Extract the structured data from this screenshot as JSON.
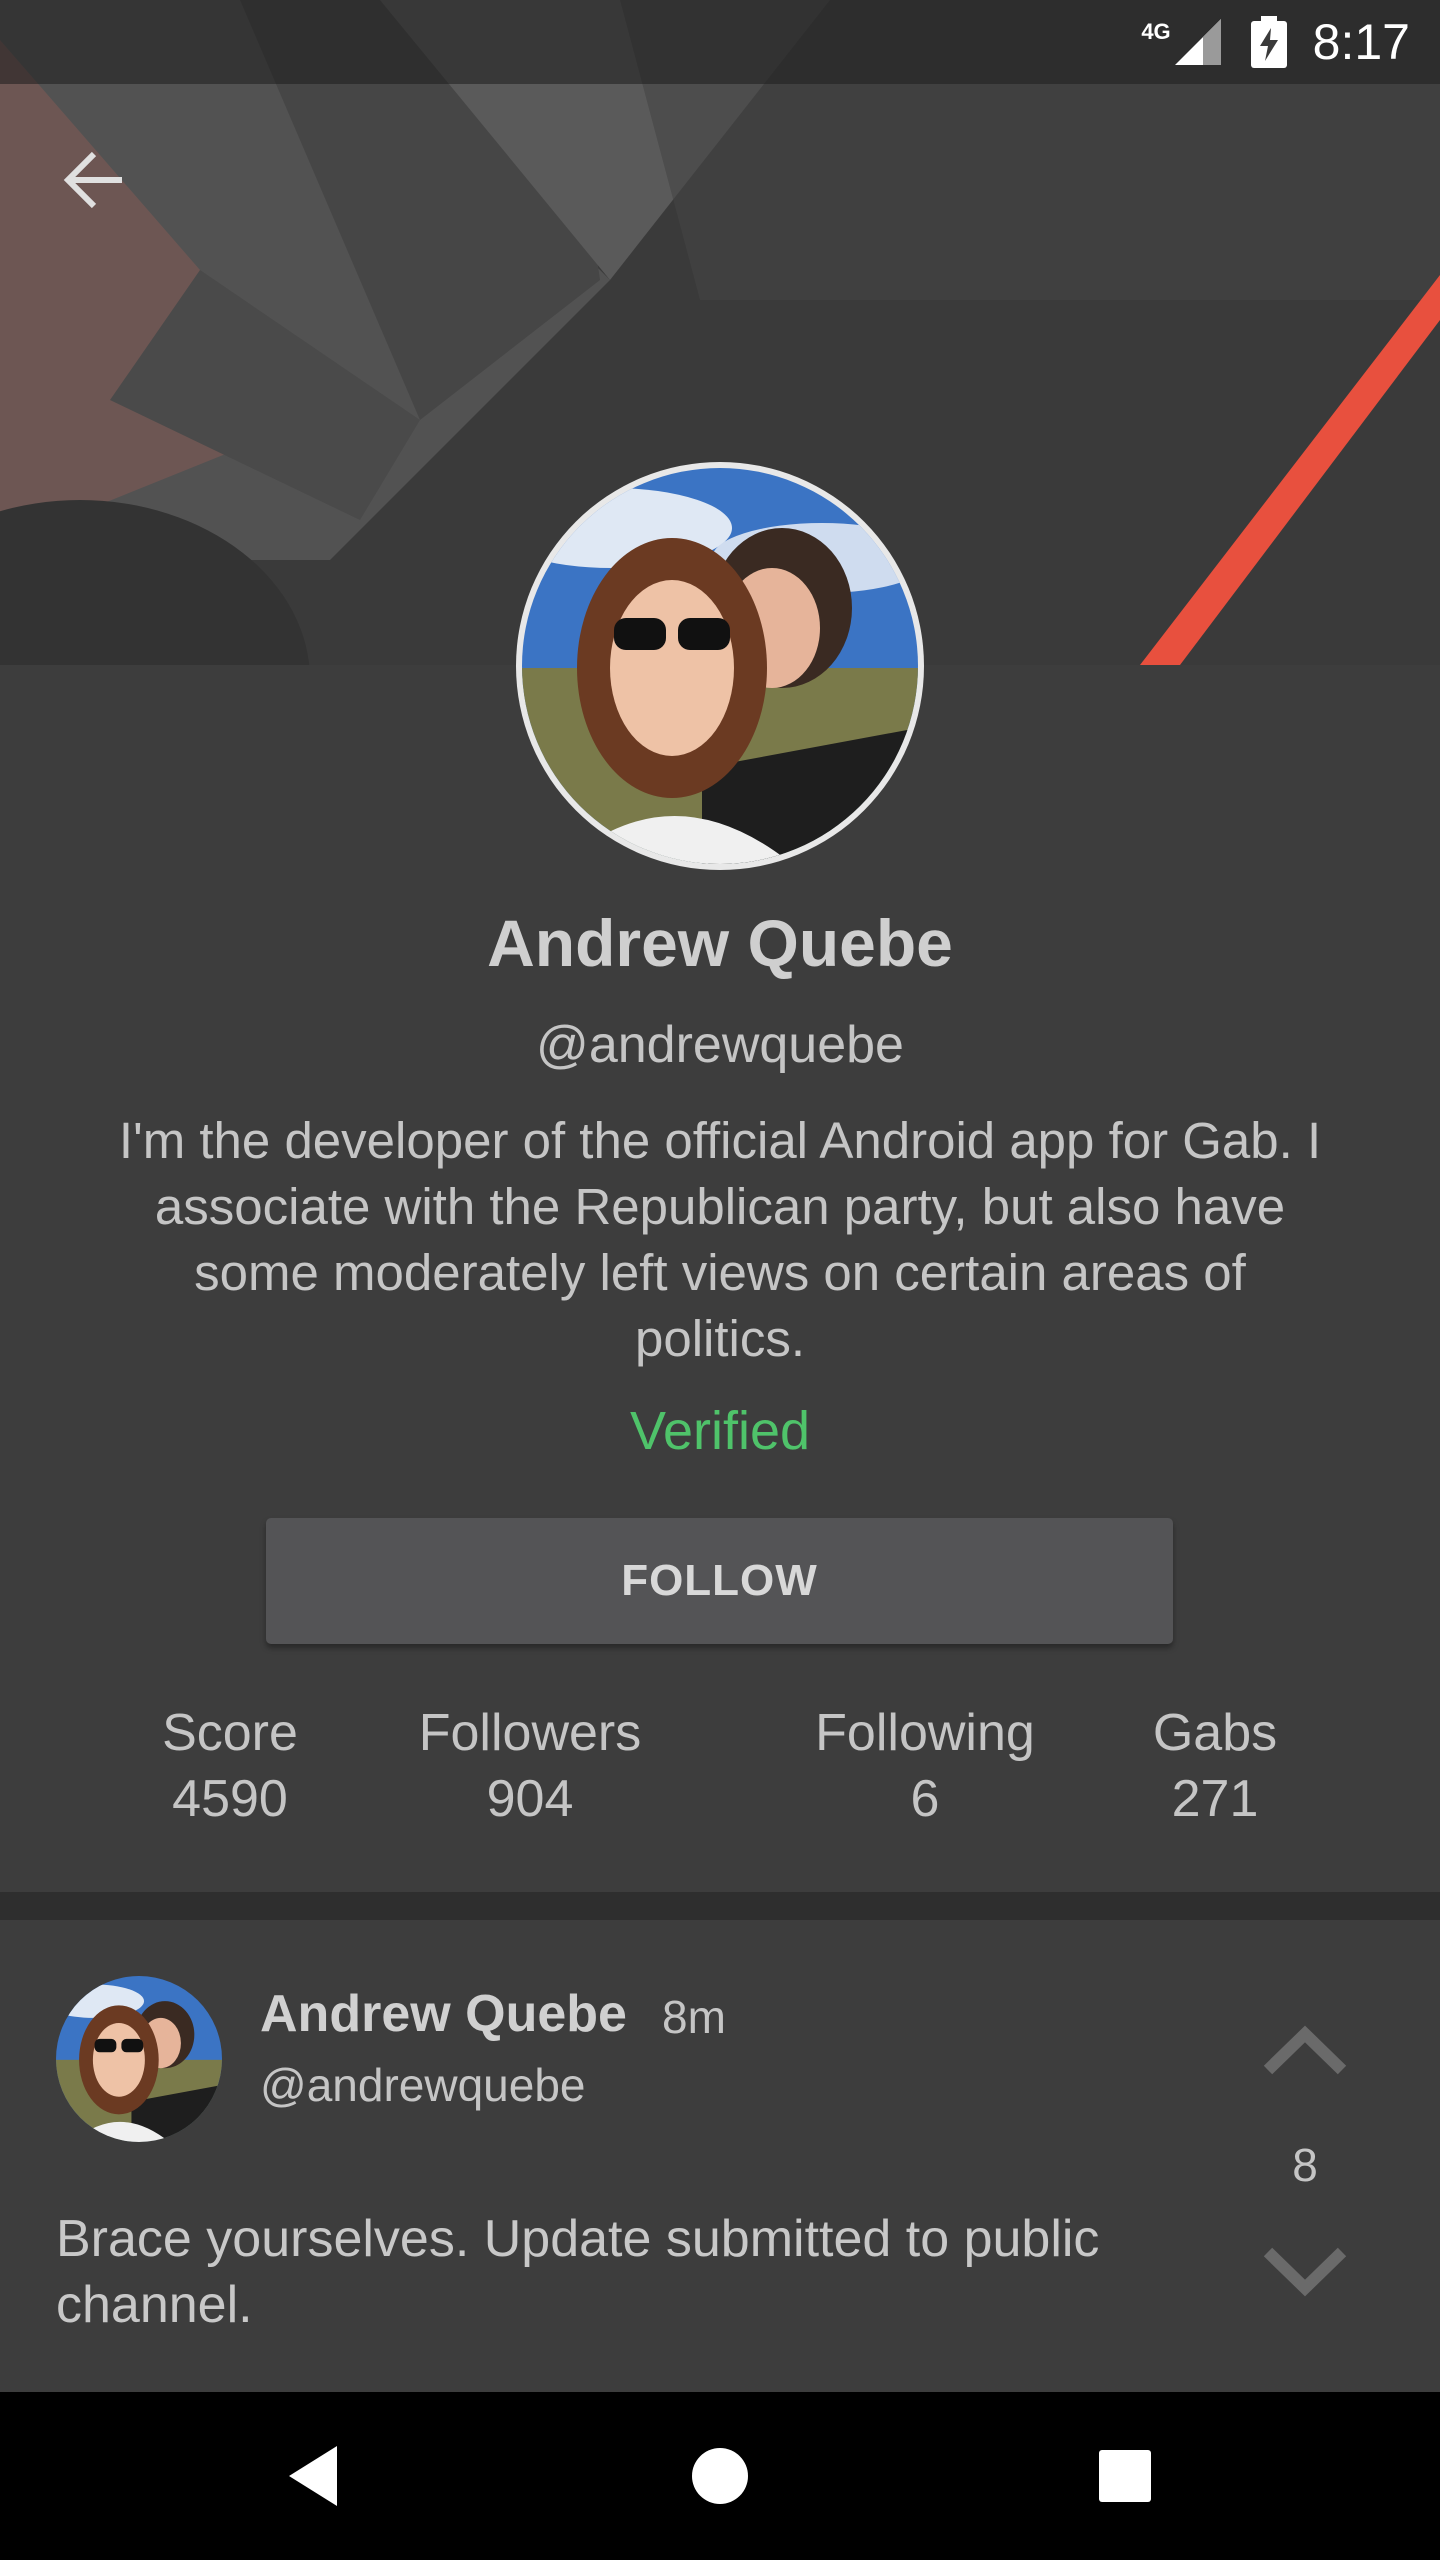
{
  "status_bar": {
    "network": "4G",
    "time": "8:17"
  },
  "profile": {
    "name": "Andrew Quebe",
    "handle": "@andrewquebe",
    "bio": "I'm the developer of the official Android app for Gab. I associate with the Republican party, but also have some moderately left views on certain areas of politics.",
    "verified_label": "Verified",
    "follow_label": "FOLLOW"
  },
  "stats": [
    {
      "label": "Score",
      "value": "4590"
    },
    {
      "label": "Followers",
      "value": "904"
    },
    {
      "label": "Following",
      "value": "6"
    },
    {
      "label": "Gabs",
      "value": "271"
    }
  ],
  "post": {
    "author": "Andrew Quebe",
    "time": "8m",
    "handle": "@andrewquebe",
    "text": "Brace yourselves. Update submitted to public channel.",
    "score": "8"
  },
  "icons": {
    "back": "arrow-back-icon",
    "upvote": "chevron-up-icon",
    "downvote": "chevron-down-icon",
    "nav_back": "triangle-back-icon",
    "nav_home": "circle-home-icon",
    "nav_recents": "square-recents-icon"
  },
  "colors": {
    "accent": "#e8503e",
    "verified": "#4fc36a",
    "background": "#3d3d3d"
  }
}
